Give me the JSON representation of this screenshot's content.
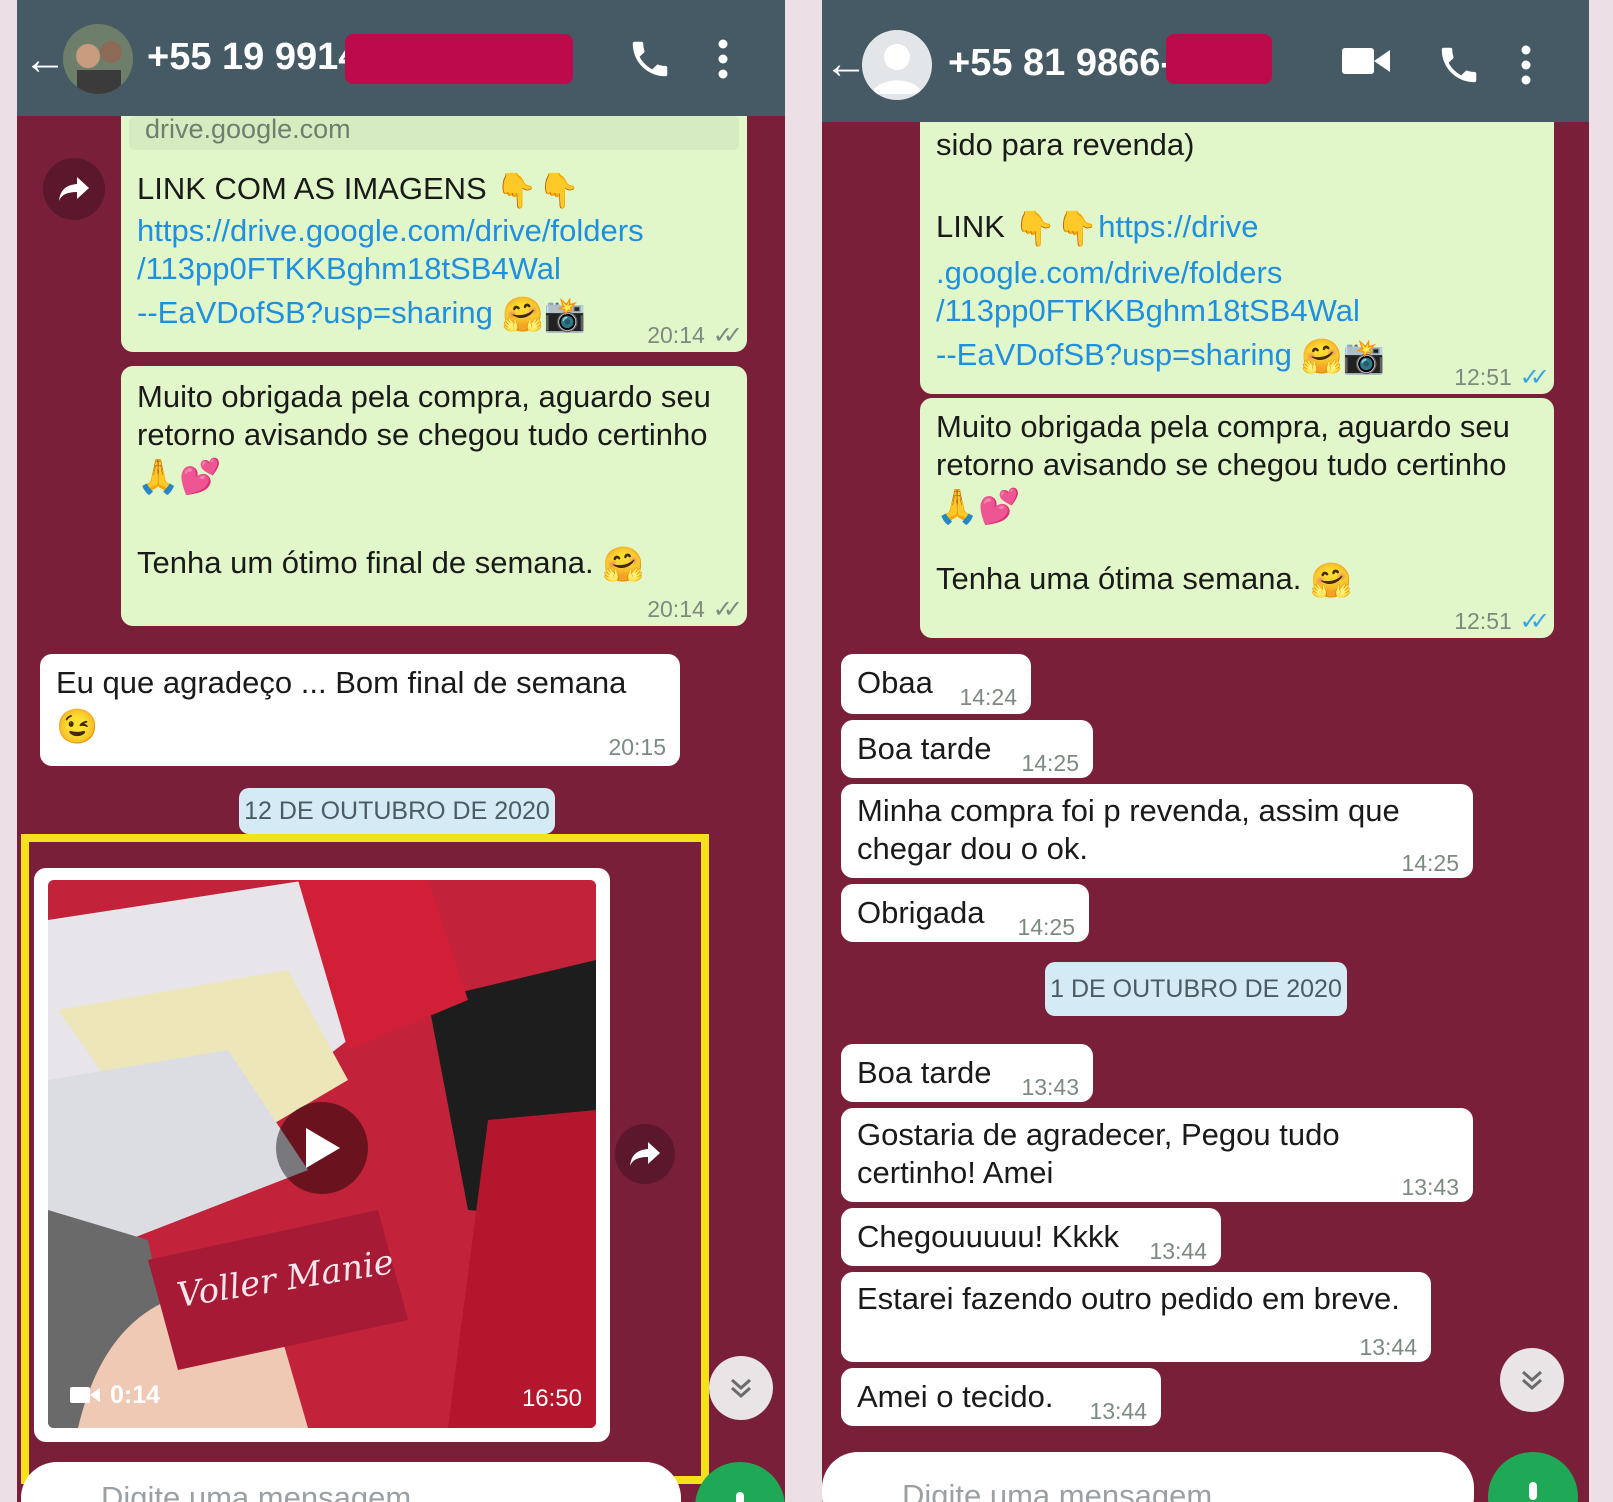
{
  "left": {
    "contact_phone": "+55 19 9914",
    "link_preview_domain": "drive.google.com",
    "link_message": {
      "title": "LINK COM AS IMAGENS",
      "title_emoji": "👇👇",
      "url_line1": "https://drive.google.com/drive/folders",
      "url_line2": "/113pp0FTKKBghm18tSB4Wal",
      "url_line3": "--EaVDofSB?usp=sharing",
      "emoji": "🤗📸",
      "time": "20:14"
    },
    "thanks_message": {
      "line1": "Muito obrigada pela compra, aguardo seu",
      "line2": "retorno avisando se chegou tudo certinho",
      "emoji1": "🙏💕",
      "line3": "Tenha um ótimo final de semana.",
      "emoji2": "🤗",
      "time": "20:14"
    },
    "reply_message": {
      "text": "Eu que agradeço ... Bom final de semana",
      "emoji": "😉",
      "time": "20:15"
    },
    "date_separator": "12 DE OUTUBRO DE 2020",
    "video_message": {
      "duration": "0:14",
      "time": "16:50",
      "card_text": "Voller Manie"
    },
    "input_placeholder": "Digite uma mensagem"
  },
  "right": {
    "contact_phone": "+55 81 9866-",
    "cut_text": "sido para revenda)",
    "link_message": {
      "title": "LINK",
      "title_emoji": "👇👇",
      "url_line1": "https://drive",
      "url_line2": ".google.com/drive/folders",
      "url_line3": "/113pp0FTKKBghm18tSB4Wal",
      "url_line4": "--EaVDofSB?usp=sharing",
      "emoji": "🤗📸",
      "time": "12:51"
    },
    "thanks_message": {
      "line1": "Muito obrigada pela compra, aguardo seu",
      "line2": "retorno avisando se chegou tudo certinho",
      "emoji1": "🙏💕",
      "line3": "Tenha uma ótima semana.",
      "emoji2": "🤗",
      "time": "12:51"
    },
    "incoming": [
      {
        "text": "Obaa",
        "time": "14:24"
      },
      {
        "text": "Boa tarde",
        "time": "14:25"
      },
      {
        "line1": "Minha compra foi p revenda, assim que",
        "line2": "chegar dou o ok.",
        "time": "14:25"
      },
      {
        "text": "Obrigada",
        "time": "14:25"
      }
    ],
    "date_separator": "1 DE OUTUBRO DE 2020",
    "incoming2": [
      {
        "text": "Boa tarde",
        "time": "13:43"
      },
      {
        "line1": "Gostaria de agradecer, Pegou tudo",
        "line2": "certinho! Amei",
        "time": "13:43"
      },
      {
        "text": "Chegouuuuu! Kkkk",
        "time": "13:44"
      },
      {
        "text": "Estarei fazendo outro pedido em breve.",
        "time": "13:44"
      },
      {
        "text": "Amei o tecido.",
        "time": "13:44"
      }
    ],
    "input_placeholder": "Digite uma mensagem"
  },
  "colors": {
    "chat_background": "#7a1f3a",
    "header": "#455a64",
    "outgoing_bubble": "#e2f7c9",
    "incoming_bubble": "#ffffff",
    "link": "#1f8fe0",
    "redaction": "#bd0a4b",
    "highlight_box": "#f5e11a",
    "fab_green": "#1fa855"
  }
}
